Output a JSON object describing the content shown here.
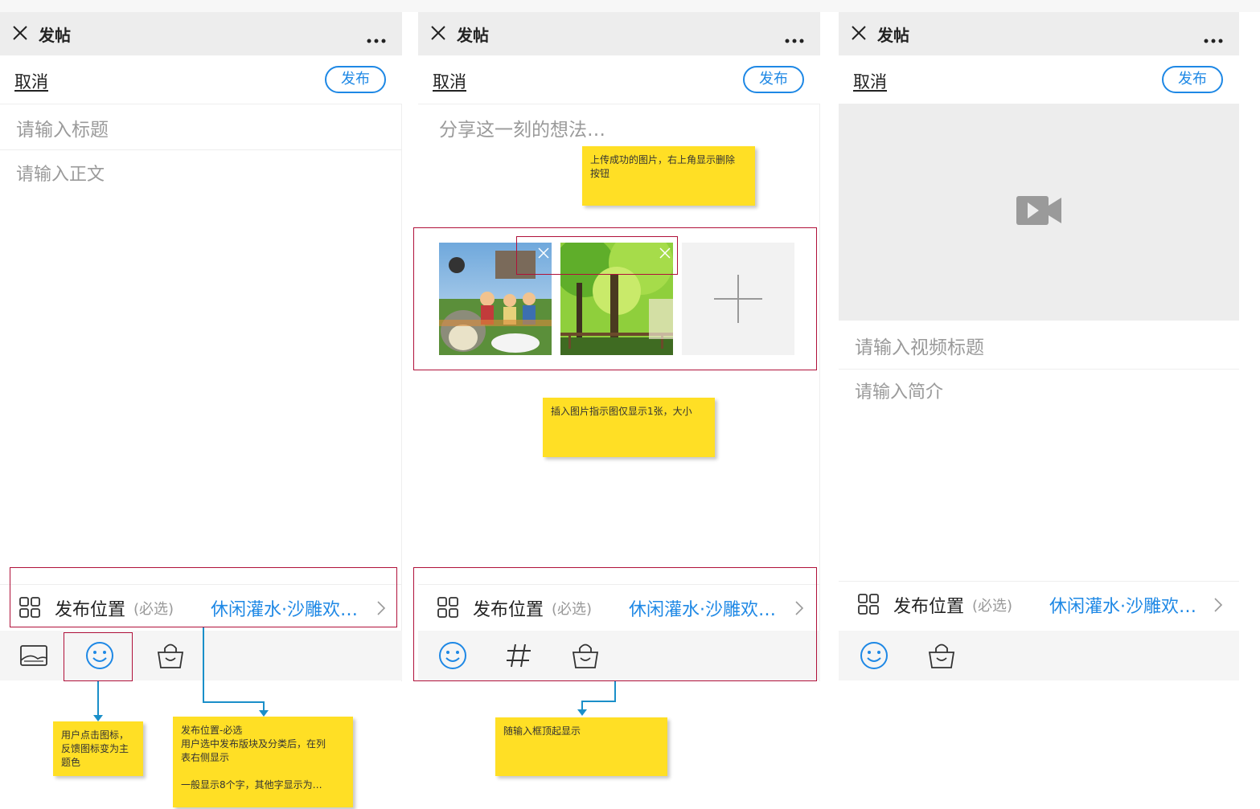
{
  "colors": {
    "accent": "#1e88e5",
    "annotation_bg": "#ffdf25",
    "highlight_border": "#b0113a",
    "connector": "#1a8fc9"
  },
  "panels": [
    {
      "wechat_title": "发帖",
      "cancel": "取消",
      "publish": "发布",
      "title_placeholder": "请输入标题",
      "body_placeholder": "请输入正文",
      "location_label": "发布位置",
      "location_required": "(必选)",
      "location_value": "休闲灌水·沙雕欢…",
      "toolbar": [
        "image-icon",
        "emoji-icon",
        "shop-bag-icon"
      ]
    },
    {
      "wechat_title": "发帖",
      "cancel": "取消",
      "publish": "发布",
      "content_placeholder": "分享这一刻的想法…",
      "location_label": "发布位置",
      "location_required": "(必选)",
      "location_value": "休闲灌水·沙雕欢…",
      "toolbar": [
        "emoji-icon",
        "hashtag-icon",
        "shop-bag-icon"
      ]
    },
    {
      "wechat_title": "发帖",
      "cancel": "取消",
      "publish": "发布",
      "video_title_placeholder": "请输入视频标题",
      "desc_placeholder": "请输入简介",
      "location_label": "发布位置",
      "location_required": "(必选)",
      "location_value": "休闲灌水·沙雕欢…",
      "toolbar": [
        "emoji-icon",
        "shop-bag-icon"
      ]
    }
  ],
  "annotations": {
    "emoji_feedback": "用户点击图标，\n反馈图标变为主\n题色",
    "location_note": "发布位置-必选\n用户选中发布版块及分类后，在列\n表右侧显示\n\n一般显示8个字，其他字显示为…",
    "uploaded_image": "上传成功的图片，右上角显示删除\n按钮",
    "insert_image": "插入图片指示图仅显示1张，大小",
    "toolbar_follow": "随输入框顶起显示"
  }
}
